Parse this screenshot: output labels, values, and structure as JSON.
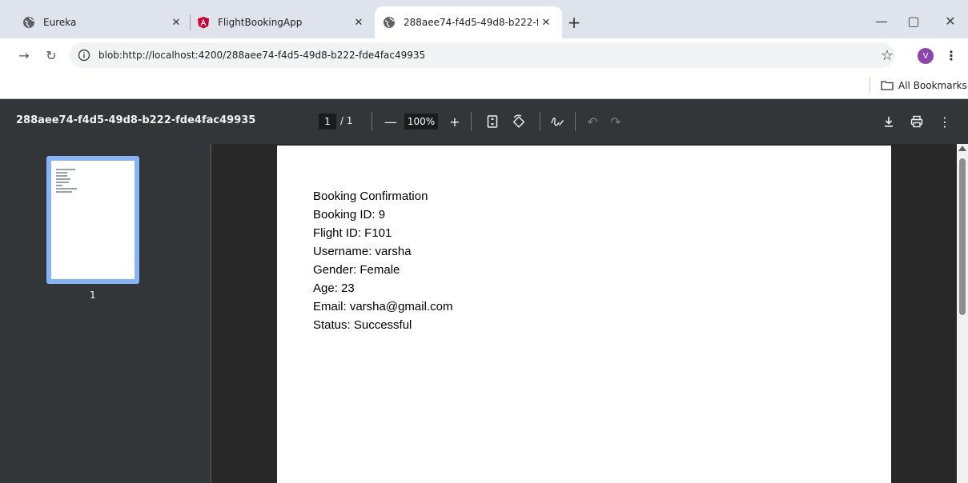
{
  "browser": {
    "tabs": [
      {
        "label": "Eureka",
        "icon": "globe-icon",
        "active": false
      },
      {
        "label": "FlightBookingApp",
        "icon": "angular-logo-icon",
        "active": false
      },
      {
        "label": "288aee74-f4d5-49d8-b222-fde",
        "icon": "globe-icon",
        "active": true
      }
    ],
    "new_tab_icon": "plus-icon",
    "window_controls": [
      "minimize-icon",
      "restore-icon",
      "close-icon"
    ],
    "address": "blob:http://localhost:4200/288aee74-f4d5-49d8-b222-fde4fac49935",
    "avatar_initial": "V",
    "avatar_color": "#8e44ad",
    "bookmarks_label": "All Bookmarks"
  },
  "pdf": {
    "title": "288aee74-f4d5-49d8-b222-fde4fac49935",
    "page_current": "1",
    "page_total": "/ 1",
    "zoom": "100%",
    "thumbnail_label": "1",
    "lines": [
      "Booking Confirmation",
      "Booking ID: 9",
      "Flight ID: F101",
      "Username: varsha",
      "Gender: Female",
      "Age: 23",
      "Email: varsha@gmail.com",
      "Status: Successful"
    ]
  }
}
